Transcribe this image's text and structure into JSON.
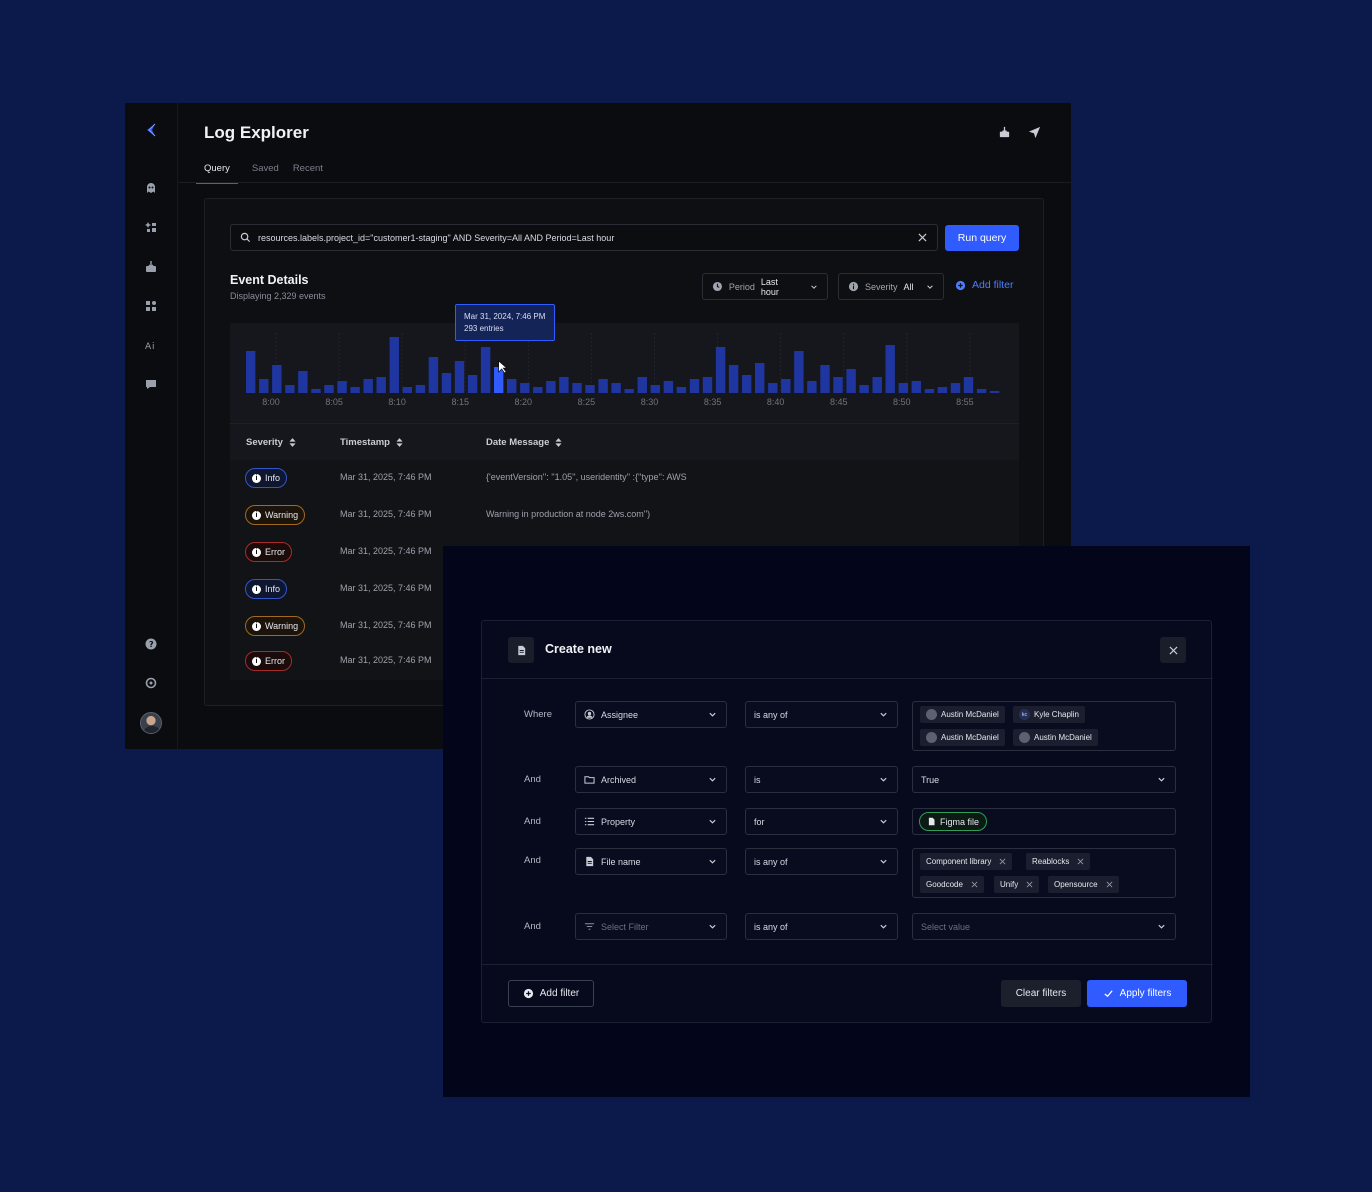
{
  "app": {
    "title": "Log Explorer"
  },
  "tabs": [
    {
      "label": "Query",
      "active": true
    },
    {
      "label": "Saved",
      "active": false
    },
    {
      "label": "Recent",
      "active": false
    }
  ],
  "sidebar": {
    "icons": [
      "logo-icon",
      "ghost-icon",
      "sparkle-grid-icon",
      "inbox-download-icon",
      "apps-icon",
      "ai-icon",
      "chat-icon",
      "help-icon",
      "settings-icon"
    ]
  },
  "header": {
    "actions": [
      "download-icon",
      "send-icon"
    ]
  },
  "search": {
    "value": "resources.labels.project_id=\"customer1-staging\" AND Severity=All AND Period=Last hour",
    "run_label": "Run query"
  },
  "events": {
    "title": "Event Details",
    "subtitle": "Displaying 2,329 events"
  },
  "filters": {
    "period_label": "Period",
    "period_value": "Last hour",
    "severity_label": "Severity",
    "severity_value": "All",
    "add_filter_label": "Add filter"
  },
  "tooltip": {
    "date": "Mar 31, 2024, 7:46 PM",
    "entries": "293 entries"
  },
  "chart_data": {
    "type": "bar",
    "tick_labels": [
      "8:00",
      "8:05",
      "8:10",
      "8:15",
      "8:20",
      "8:25",
      "8:30",
      "8:35",
      "8:40",
      "8:45",
      "8:50",
      "8:55"
    ],
    "values": [
      42,
      14,
      28,
      8,
      22,
      4,
      8,
      12,
      6,
      14,
      16,
      56,
      6,
      8,
      36,
      20,
      32,
      18,
      46,
      26,
      14,
      10,
      6,
      12,
      16,
      10,
      8,
      14,
      10,
      4,
      16,
      8,
      12,
      6,
      14,
      16,
      46,
      28,
      18,
      30,
      10,
      14,
      42,
      12,
      28,
      16,
      24,
      8,
      16,
      48,
      10,
      12,
      4,
      6,
      10,
      16,
      4,
      2
    ],
    "highlight_index": 19,
    "colors": {
      "bar": "#1f36a0",
      "highlight": "#2f5bff"
    }
  },
  "table": {
    "columns": [
      "Severity",
      "Timestamp",
      "Date Message"
    ],
    "rows": [
      {
        "severity": "Info",
        "level": "info",
        "timestamp": "Mar 31, 2025, 7:46 PM",
        "message": "{'eventVersion'': ''1.05'', useridentity'' :{''type'': AWS"
      },
      {
        "severity": "Warning",
        "level": "warning",
        "timestamp": "Mar 31, 2025, 7:46 PM",
        "message": "Warning in production at node 2ws.com'')"
      },
      {
        "severity": "Error",
        "level": "error",
        "timestamp": "Mar 31, 2025, 7:46 PM",
        "message": ""
      },
      {
        "severity": "Info",
        "level": "info",
        "timestamp": "Mar 31, 2025, 7:46 PM",
        "message": ""
      },
      {
        "severity": "Warning",
        "level": "warning",
        "timestamp": "Mar 31, 2025, 7:46 PM",
        "message": ""
      },
      {
        "severity": "Error",
        "level": "error",
        "timestamp": "Mar 31, 2025, 7:46 PM",
        "message": ""
      }
    ]
  },
  "dialog": {
    "title": "Create new",
    "rows": [
      {
        "conj": "Where",
        "field": "Assignee",
        "op": "is any of"
      },
      {
        "conj": "And",
        "field": "Archived",
        "op": "is",
        "value": "True"
      },
      {
        "conj": "And",
        "field": "Property",
        "op": "for",
        "value": "Figma file"
      },
      {
        "conj": "And",
        "field": "File name",
        "op": "is any of"
      },
      {
        "conj": "And",
        "field": "Select Filter",
        "op": "is any of",
        "value": "Select value"
      }
    ],
    "assignees": [
      "Austin McDaniel",
      "Kyle Chaplin",
      "Austin McDaniel",
      "Austin McDaniel"
    ],
    "assignee_initials": "kc",
    "file_names": [
      "Component library",
      "Reablocks",
      "Goodcode",
      "Unify",
      "Opensource"
    ],
    "add_filter_label": "Add filter",
    "clear_label": "Clear filters",
    "apply_label": "Apply filters"
  }
}
